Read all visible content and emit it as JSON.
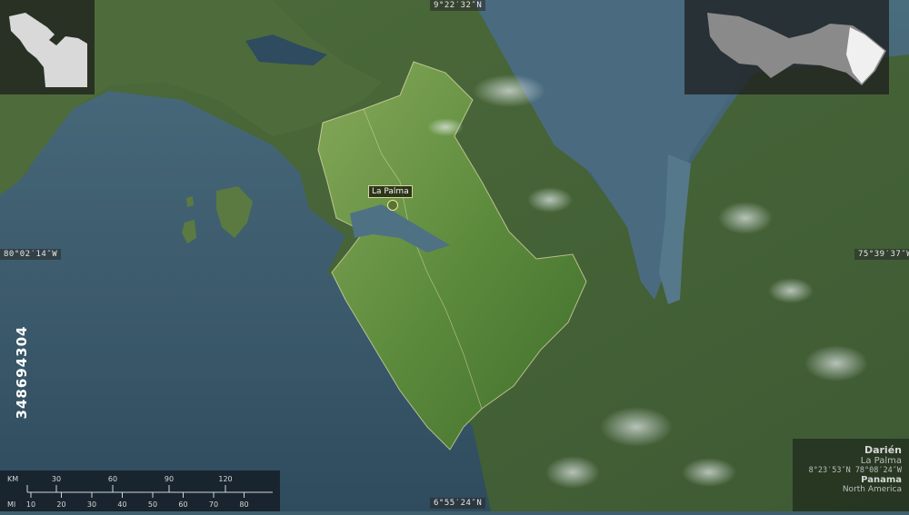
{
  "map": {
    "coordinates": {
      "top": "9°22′32″N",
      "bottom": "6°55′24″N",
      "left": "80°02′14″W",
      "right": "75°39′37″W"
    },
    "place_label": "La Palma",
    "info_box": {
      "region": "Darién",
      "capital": "La Palma",
      "capital_coords": "8°23′53″N 78°08′24″W",
      "country": "Panama",
      "continent": "North America"
    },
    "scale_bar": {
      "km_label": "KM",
      "km_ticks": [
        "30",
        "60",
        "90",
        "120"
      ],
      "mi_label": "MI",
      "mi_ticks": [
        "10",
        "20",
        "30",
        "40",
        "50",
        "60",
        "70",
        "80"
      ]
    },
    "stock_id": "348694304",
    "colors": {
      "sea": "#3f5f70",
      "land": "#4f6a3c",
      "region_highlight": "#6f9a48",
      "label_border": "#d9d2a0"
    }
  }
}
